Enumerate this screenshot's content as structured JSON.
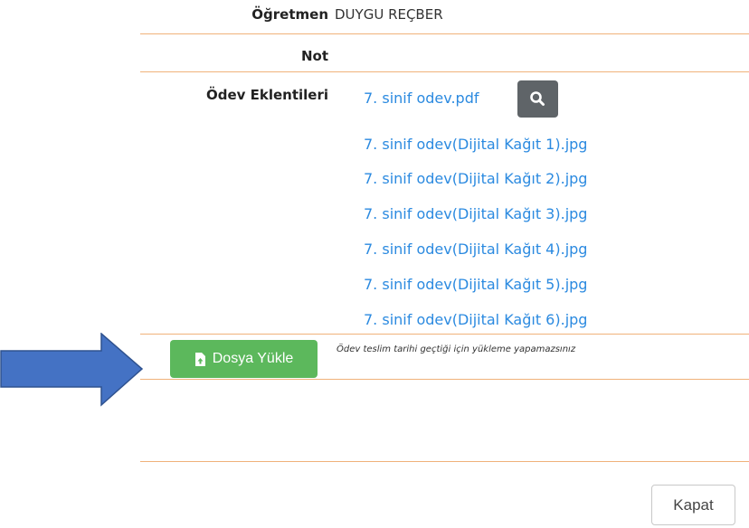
{
  "details": {
    "teacher_label": "Öğretmen",
    "teacher_value": "DUYGU REÇBER",
    "note_label": "Not",
    "attachments_label": "Ödev Eklentileri"
  },
  "attachments": [
    "7. sinif odev.pdf",
    "7. sinif odev(Dijital Kağıt 1).jpg",
    "7. sinif odev(Dijital Kağıt 2).jpg",
    "7. sinif odev(Dijital Kağıt 3).jpg",
    "7. sinif odev(Dijital Kağıt 4).jpg",
    "7. sinif odev(Dijital Kağıt 5).jpg",
    "7. sinif odev(Dijital Kağıt 6).jpg"
  ],
  "upload": {
    "button_label": "Dosya Yükle",
    "note": "Ödev teslim tarihi geçtiği için yükleme yapamazsınız"
  },
  "footer": {
    "close_label": "Kapat"
  },
  "colors": {
    "link": "#2b8ae0",
    "divider": "#f0b27a",
    "upload_button": "#5cb85c",
    "search_button": "#5f6468",
    "annotation_arrow": "#4472c4"
  },
  "icons": {
    "search": "search-icon",
    "upload": "file-upload-icon",
    "annotation": "arrow-right-icon"
  }
}
